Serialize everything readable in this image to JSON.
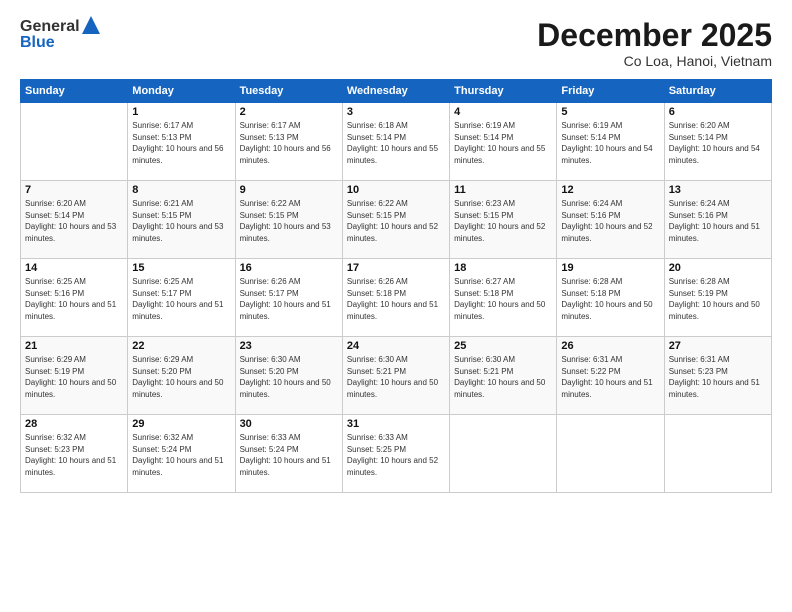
{
  "header": {
    "logo_general": "General",
    "logo_blue": "Blue",
    "month_title": "December 2025",
    "location": "Co Loa, Hanoi, Vietnam"
  },
  "days_of_week": [
    "Sunday",
    "Monday",
    "Tuesday",
    "Wednesday",
    "Thursday",
    "Friday",
    "Saturday"
  ],
  "weeks": [
    [
      {
        "day": "",
        "sunrise": "",
        "sunset": "",
        "daylight": ""
      },
      {
        "day": "1",
        "sunrise": "Sunrise: 6:17 AM",
        "sunset": "Sunset: 5:13 PM",
        "daylight": "Daylight: 10 hours and 56 minutes."
      },
      {
        "day": "2",
        "sunrise": "Sunrise: 6:17 AM",
        "sunset": "Sunset: 5:13 PM",
        "daylight": "Daylight: 10 hours and 56 minutes."
      },
      {
        "day": "3",
        "sunrise": "Sunrise: 6:18 AM",
        "sunset": "Sunset: 5:14 PM",
        "daylight": "Daylight: 10 hours and 55 minutes."
      },
      {
        "day": "4",
        "sunrise": "Sunrise: 6:19 AM",
        "sunset": "Sunset: 5:14 PM",
        "daylight": "Daylight: 10 hours and 55 minutes."
      },
      {
        "day": "5",
        "sunrise": "Sunrise: 6:19 AM",
        "sunset": "Sunset: 5:14 PM",
        "daylight": "Daylight: 10 hours and 54 minutes."
      },
      {
        "day": "6",
        "sunrise": "Sunrise: 6:20 AM",
        "sunset": "Sunset: 5:14 PM",
        "daylight": "Daylight: 10 hours and 54 minutes."
      }
    ],
    [
      {
        "day": "7",
        "sunrise": "Sunrise: 6:20 AM",
        "sunset": "Sunset: 5:14 PM",
        "daylight": "Daylight: 10 hours and 53 minutes."
      },
      {
        "day": "8",
        "sunrise": "Sunrise: 6:21 AM",
        "sunset": "Sunset: 5:15 PM",
        "daylight": "Daylight: 10 hours and 53 minutes."
      },
      {
        "day": "9",
        "sunrise": "Sunrise: 6:22 AM",
        "sunset": "Sunset: 5:15 PM",
        "daylight": "Daylight: 10 hours and 53 minutes."
      },
      {
        "day": "10",
        "sunrise": "Sunrise: 6:22 AM",
        "sunset": "Sunset: 5:15 PM",
        "daylight": "Daylight: 10 hours and 52 minutes."
      },
      {
        "day": "11",
        "sunrise": "Sunrise: 6:23 AM",
        "sunset": "Sunset: 5:15 PM",
        "daylight": "Daylight: 10 hours and 52 minutes."
      },
      {
        "day": "12",
        "sunrise": "Sunrise: 6:24 AM",
        "sunset": "Sunset: 5:16 PM",
        "daylight": "Daylight: 10 hours and 52 minutes."
      },
      {
        "day": "13",
        "sunrise": "Sunrise: 6:24 AM",
        "sunset": "Sunset: 5:16 PM",
        "daylight": "Daylight: 10 hours and 51 minutes."
      }
    ],
    [
      {
        "day": "14",
        "sunrise": "Sunrise: 6:25 AM",
        "sunset": "Sunset: 5:16 PM",
        "daylight": "Daylight: 10 hours and 51 minutes."
      },
      {
        "day": "15",
        "sunrise": "Sunrise: 6:25 AM",
        "sunset": "Sunset: 5:17 PM",
        "daylight": "Daylight: 10 hours and 51 minutes."
      },
      {
        "day": "16",
        "sunrise": "Sunrise: 6:26 AM",
        "sunset": "Sunset: 5:17 PM",
        "daylight": "Daylight: 10 hours and 51 minutes."
      },
      {
        "day": "17",
        "sunrise": "Sunrise: 6:26 AM",
        "sunset": "Sunset: 5:18 PM",
        "daylight": "Daylight: 10 hours and 51 minutes."
      },
      {
        "day": "18",
        "sunrise": "Sunrise: 6:27 AM",
        "sunset": "Sunset: 5:18 PM",
        "daylight": "Daylight: 10 hours and 50 minutes."
      },
      {
        "day": "19",
        "sunrise": "Sunrise: 6:28 AM",
        "sunset": "Sunset: 5:18 PM",
        "daylight": "Daylight: 10 hours and 50 minutes."
      },
      {
        "day": "20",
        "sunrise": "Sunrise: 6:28 AM",
        "sunset": "Sunset: 5:19 PM",
        "daylight": "Daylight: 10 hours and 50 minutes."
      }
    ],
    [
      {
        "day": "21",
        "sunrise": "Sunrise: 6:29 AM",
        "sunset": "Sunset: 5:19 PM",
        "daylight": "Daylight: 10 hours and 50 minutes."
      },
      {
        "day": "22",
        "sunrise": "Sunrise: 6:29 AM",
        "sunset": "Sunset: 5:20 PM",
        "daylight": "Daylight: 10 hours and 50 minutes."
      },
      {
        "day": "23",
        "sunrise": "Sunrise: 6:30 AM",
        "sunset": "Sunset: 5:20 PM",
        "daylight": "Daylight: 10 hours and 50 minutes."
      },
      {
        "day": "24",
        "sunrise": "Sunrise: 6:30 AM",
        "sunset": "Sunset: 5:21 PM",
        "daylight": "Daylight: 10 hours and 50 minutes."
      },
      {
        "day": "25",
        "sunrise": "Sunrise: 6:30 AM",
        "sunset": "Sunset: 5:21 PM",
        "daylight": "Daylight: 10 hours and 50 minutes."
      },
      {
        "day": "26",
        "sunrise": "Sunrise: 6:31 AM",
        "sunset": "Sunset: 5:22 PM",
        "daylight": "Daylight: 10 hours and 51 minutes."
      },
      {
        "day": "27",
        "sunrise": "Sunrise: 6:31 AM",
        "sunset": "Sunset: 5:23 PM",
        "daylight": "Daylight: 10 hours and 51 minutes."
      }
    ],
    [
      {
        "day": "28",
        "sunrise": "Sunrise: 6:32 AM",
        "sunset": "Sunset: 5:23 PM",
        "daylight": "Daylight: 10 hours and 51 minutes."
      },
      {
        "day": "29",
        "sunrise": "Sunrise: 6:32 AM",
        "sunset": "Sunset: 5:24 PM",
        "daylight": "Daylight: 10 hours and 51 minutes."
      },
      {
        "day": "30",
        "sunrise": "Sunrise: 6:33 AM",
        "sunset": "Sunset: 5:24 PM",
        "daylight": "Daylight: 10 hours and 51 minutes."
      },
      {
        "day": "31",
        "sunrise": "Sunrise: 6:33 AM",
        "sunset": "Sunset: 5:25 PM",
        "daylight": "Daylight: 10 hours and 52 minutes."
      },
      {
        "day": "",
        "sunrise": "",
        "sunset": "",
        "daylight": ""
      },
      {
        "day": "",
        "sunrise": "",
        "sunset": "",
        "daylight": ""
      },
      {
        "day": "",
        "sunrise": "",
        "sunset": "",
        "daylight": ""
      }
    ]
  ]
}
